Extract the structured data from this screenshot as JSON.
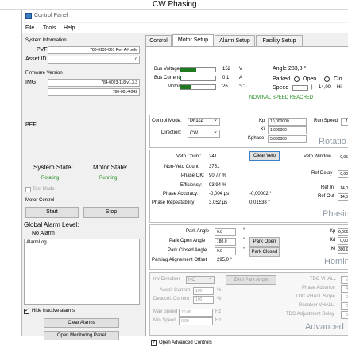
{
  "sheet": {
    "title": "CW Phasing"
  },
  "window": {
    "title": "Control Panel"
  },
  "menu": [
    "File",
    "Tools",
    "Help"
  ],
  "left": {
    "sysinfo": {
      "title": "System Information",
      "pvf_label": "PVF",
      "pvf_value": "780-0130-061 Rev A# pofe",
      "asset_label": "Asset ID",
      "asset_value": "0"
    },
    "firmware": {
      "title": "Firmware Version",
      "img_label": "IMG",
      "img_value1": "784-0023-118 v1.3.3",
      "img_value2": "780-0014-042",
      "pef_label": "PEF"
    },
    "state": {
      "system_label": "System State:",
      "system_value": "Rotating",
      "motor_label": "Motor State:",
      "motor_value": "Running"
    },
    "test_mode": "Test Mode",
    "motor_control": {
      "title": "Motor Control",
      "start": "Start",
      "stop": "Stop"
    },
    "alarm": {
      "level_label": "Global Alarm Level:",
      "level_value": "No Alarm",
      "log_label": "AlarmLog"
    },
    "hide_inactive": "Hide inactive alarms",
    "clear_alarms": "Clear Alarms",
    "open_monitoring": "Open Monitoring Panel"
  },
  "tabs": [
    {
      "label": "Control"
    },
    {
      "label": "Motor Setup"
    },
    {
      "label": "Alarm Setup"
    },
    {
      "label": "Facility Setup"
    }
  ],
  "status": {
    "bus_voltage_label": "Bus Voltage",
    "bus_voltage_value": "152",
    "bus_voltage_unit": "V",
    "bus_voltage_fraction": 0.45,
    "bus_current_label": "Bus Current",
    "bus_current_value": "0,1",
    "bus_current_unit": "A",
    "bus_current_fraction": 0.01,
    "motor_label": "Motor",
    "motor_value": "26",
    "motor_unit": "°C",
    "motor_fraction": 0.3,
    "angle_label": "Angle",
    "angle_value": "283,8 °",
    "parked_label": "Parked",
    "open_label": "Open",
    "closed_label": "Clo",
    "speed_label": "Speed",
    "speed_value": "14,00",
    "speed_unit": "Hi",
    "nominal": "NOMINAL SPEED REACHED"
  },
  "rotation": {
    "control_mode_label": "Control Mode:",
    "control_mode_value": "Phase",
    "direction_label": "Direction:",
    "direction_value": "CW",
    "kp_label": "Kp",
    "kp_value": "10,000000",
    "ki_label": "Ki",
    "ki_value": "1,000000",
    "kphase_label": "Kphase",
    "kphase_value": "5,000000",
    "runspeed_label": "Run Speed",
    "runspeed_value": "1",
    "title": "Rotatio"
  },
  "phasing": {
    "veto_count_label": "Veto Count:",
    "veto_count_value": "241",
    "clear_veto": "Clear Veto",
    "veto_window_label": "Veto Window",
    "veto_window_value": "0,05",
    "nonveto_label": "Non-Veto Count:",
    "nonveto_value": "3751",
    "phase_ok_label": "Phase OK:",
    "phase_ok_value": "90,77 %",
    "ref_delay_label": "Ref Delay",
    "ref_delay_value": "0,00",
    "efficiency_label": "Efficiency:",
    "efficiency_value": "93,94 %",
    "ref_in_label": "Ref In",
    "ref_in_value": "14,0",
    "accuracy_label": "Phase Accuracy:",
    "accuracy_value1": "-0,004 µs",
    "accuracy_value2": "-0,00002 °",
    "ref_out_label": "Ref Out",
    "ref_out_value": "14,0",
    "repeatability_label": "Phase Repeatability:",
    "repeatability_value1": "3,052 µs",
    "repeatability_value2": "0,01538 °",
    "title": "Phasin"
  },
  "homing": {
    "park_angle_label": "Park Angle",
    "park_angle_value": "0.0",
    "park_open_label": "Park Open Angle",
    "park_open_value": "180.0",
    "park_open_btn": "Park Open",
    "park_closed_label": "Park Closed Angle",
    "park_closed_value": "0.0",
    "park_closed_btn": "Park Closed",
    "offset_label": "Parking Alignement Offset",
    "offset_value": "295,0 °",
    "kp_label": "Kp",
    "kp_value": "6,000",
    "kd_label": "Kd",
    "kd_value": "0,00",
    "ki_label": "Ki",
    "ki_value": "300,0",
    "degree": "°",
    "title": "Homin"
  },
  "advanced": {
    "inv_direction_label": "Inv Direction",
    "inv_direction_value": "NO",
    "zero_park": "Zero Park Angle",
    "accel_label": "Accel. Current",
    "accel_value": "100",
    "accel_unit": "%",
    "deaccel_label": "Deaccel. Current",
    "deaccel_value": "100",
    "deaccel_unit": "%",
    "max_speed_label": "Max Speed",
    "max_speed_value": "70,00",
    "max_speed_unit": "Hz",
    "min_speed_label": "Min Speed",
    "min_speed_value": "0,00",
    "min_speed_unit": "Hz",
    "tdc_vhall_label": "TDC VHALL",
    "tdc_vhall_value": "2",
    "phase_adv_label": "Phase Advance",
    "phase_adv_value": "4",
    "tdc_slope_label": "TDC VHALL Slope",
    "tdc_slope_value": "0",
    "resolver_label": "Resolver VHALL",
    "resolver_value": "0",
    "tdc_adj_label": "TDC Adjustment Delay",
    "tdc_adj_value": "3",
    "title": "Advanced",
    "open_advanced": "Open Advanced Controls"
  }
}
